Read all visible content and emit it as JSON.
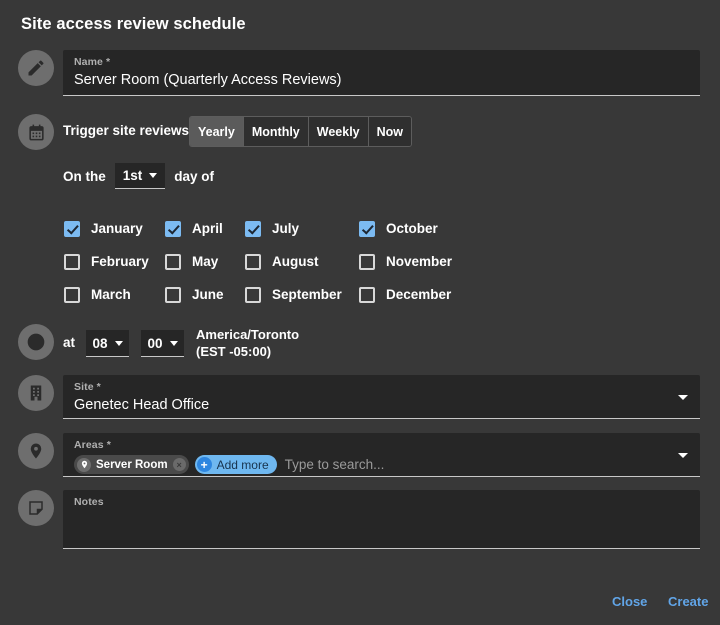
{
  "dialog": {
    "title": "Site access review schedule"
  },
  "name_field": {
    "icon": "pencil-icon",
    "label": "Name *",
    "value": "Server Room (Quarterly Access Reviews)"
  },
  "trigger": {
    "icon": "calendar-icon",
    "label": "Trigger site reviews",
    "options": [
      "Yearly",
      "Monthly",
      "Weekly",
      "Now"
    ],
    "selected": "Yearly"
  },
  "day_of": {
    "prefix": "On the",
    "day": "1st",
    "suffix": "day of"
  },
  "months": {
    "columns": [
      [
        {
          "label": "January",
          "checked": true
        },
        {
          "label": "February",
          "checked": false
        },
        {
          "label": "March",
          "checked": false
        }
      ],
      [
        {
          "label": "April",
          "checked": true
        },
        {
          "label": "May",
          "checked": false
        },
        {
          "label": "June",
          "checked": false
        }
      ],
      [
        {
          "label": "July",
          "checked": true
        },
        {
          "label": "August",
          "checked": false
        },
        {
          "label": "September",
          "checked": false
        }
      ],
      [
        {
          "label": "October",
          "checked": true
        },
        {
          "label": "November",
          "checked": false
        },
        {
          "label": "December",
          "checked": false
        }
      ]
    ]
  },
  "time": {
    "icon": "clock-icon",
    "at_label": "at",
    "hour": "08",
    "minute": "00",
    "timezone_name": "America/Toronto",
    "timezone_offset": "(EST -05:00)"
  },
  "site_field": {
    "icon": "building-icon",
    "label": "Site *",
    "value": "Genetec Head Office"
  },
  "areas_field": {
    "icon": "location-pin-icon",
    "label": "Areas *",
    "chips": [
      {
        "label": "Server Room",
        "icon": "location-pin-icon",
        "remove": "×"
      }
    ],
    "add_more_label": "Add more",
    "add_more_icon": "+",
    "placeholder": "Type to search..."
  },
  "notes_field": {
    "icon": "note-icon",
    "label": "Notes",
    "value": ""
  },
  "footer": {
    "close_label": "Close",
    "create_label": "Create"
  },
  "colors": {
    "background": "#383838",
    "field_background": "#262626",
    "accent_blue": "#61a5e8",
    "checkbox_blue": "#7cbbf2",
    "chip_blue": "#6fb8f0"
  }
}
